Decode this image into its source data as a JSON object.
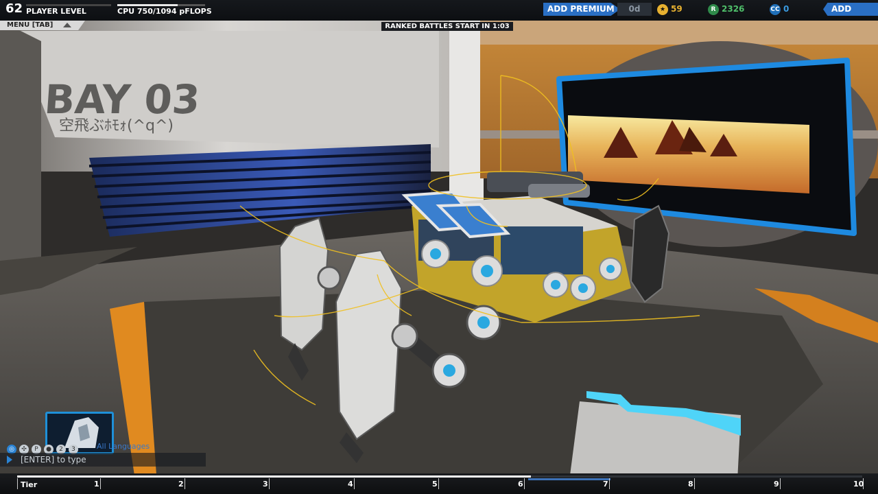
{
  "hud": {
    "player_level": "62",
    "player_level_label": "PLAYER LEVEL",
    "cpu_label": "CPU 750/1094 pFLOPS",
    "cpu_used": 750,
    "cpu_max": 1094,
    "add_premium": "ADD PREMIUM",
    "premium_days": "0d",
    "stars": "59",
    "robits": "2326",
    "cosmetic_credits": "0",
    "add_funds": "ADD FUNDS",
    "colors": {
      "accent_blue": "#2a6fc4",
      "robits_green": "#4fbf6a",
      "cc_blue": "#3a9be0",
      "star_gold": "#e6b030"
    }
  },
  "menu": {
    "label": "MENU [TAB]"
  },
  "banner": {
    "ranked": "RANKED BATTLES START IN 1:03"
  },
  "garage": {
    "bay_title": "BAY 03",
    "robot_name": "空飛ぶﾎﾓｫ(^q^)"
  },
  "chat": {
    "language": "All Languages",
    "placeholder": "[ENTER] to type",
    "icons": [
      "globe-icon",
      "clan-icon",
      "party-icon",
      "friends-icon",
      "group-2-icon",
      "group-3-icon"
    ],
    "group_2": "2",
    "group_3": "3",
    "party_letter": "P"
  },
  "tier": {
    "label": "Tier",
    "ticks": [
      "1",
      "2",
      "3",
      "4",
      "5",
      "6",
      "7",
      "8",
      "9",
      "10"
    ],
    "progress_fraction": 0.608
  }
}
